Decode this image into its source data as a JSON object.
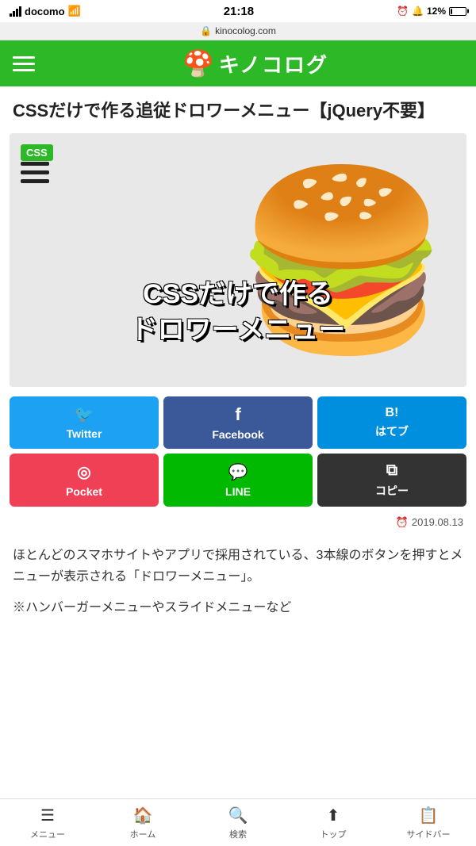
{
  "status_bar": {
    "carrier": "docomo",
    "time": "21:18",
    "battery_percent": "12%"
  },
  "url_bar": {
    "url": "kinocolog.com"
  },
  "header": {
    "logo_text": "キノコログ",
    "menu_icon": "≡"
  },
  "article": {
    "title": "CSSだけで作る追従ドロワーメニュー【jQuery不要】",
    "css_badge": "CSS",
    "hero_text_line1": "CSSだけで作る",
    "hero_text_line2": "ドロワーメニュー",
    "date_label": "2019.08.13"
  },
  "share_buttons": [
    {
      "id": "twitter",
      "icon": "𝕏",
      "label": "Twitter",
      "style": "twitter"
    },
    {
      "id": "facebook",
      "icon": "f",
      "label": "Facebook",
      "style": "facebook"
    },
    {
      "id": "hatena",
      "icon": "B!",
      "label": "はてブ",
      "style": "hatena"
    },
    {
      "id": "pocket",
      "icon": "◎",
      "label": "Pocket",
      "style": "pocket"
    },
    {
      "id": "line",
      "icon": "LINE",
      "label": "LINE",
      "style": "line"
    },
    {
      "id": "copy",
      "icon": "⧉",
      "label": "コピー",
      "style": "copy"
    }
  ],
  "article_body": {
    "paragraph1": "ほとんどのスマホサイトやアプリで採用されている、3本線のボタンを押すとメニューが表示される「ドロワーメニュー」。",
    "paragraph2": "※ハンバーガーメニューやスライドメニューなど"
  },
  "bottom_nav": {
    "items": [
      {
        "id": "menu",
        "icon": "≡",
        "label": "メニュー"
      },
      {
        "id": "home",
        "icon": "⌂",
        "label": "ホーム"
      },
      {
        "id": "search",
        "icon": "🔍",
        "label": "検索"
      },
      {
        "id": "top",
        "icon": "↑",
        "label": "トップ"
      },
      {
        "id": "sidebar",
        "icon": "☰",
        "label": "サイドバー"
      }
    ]
  }
}
